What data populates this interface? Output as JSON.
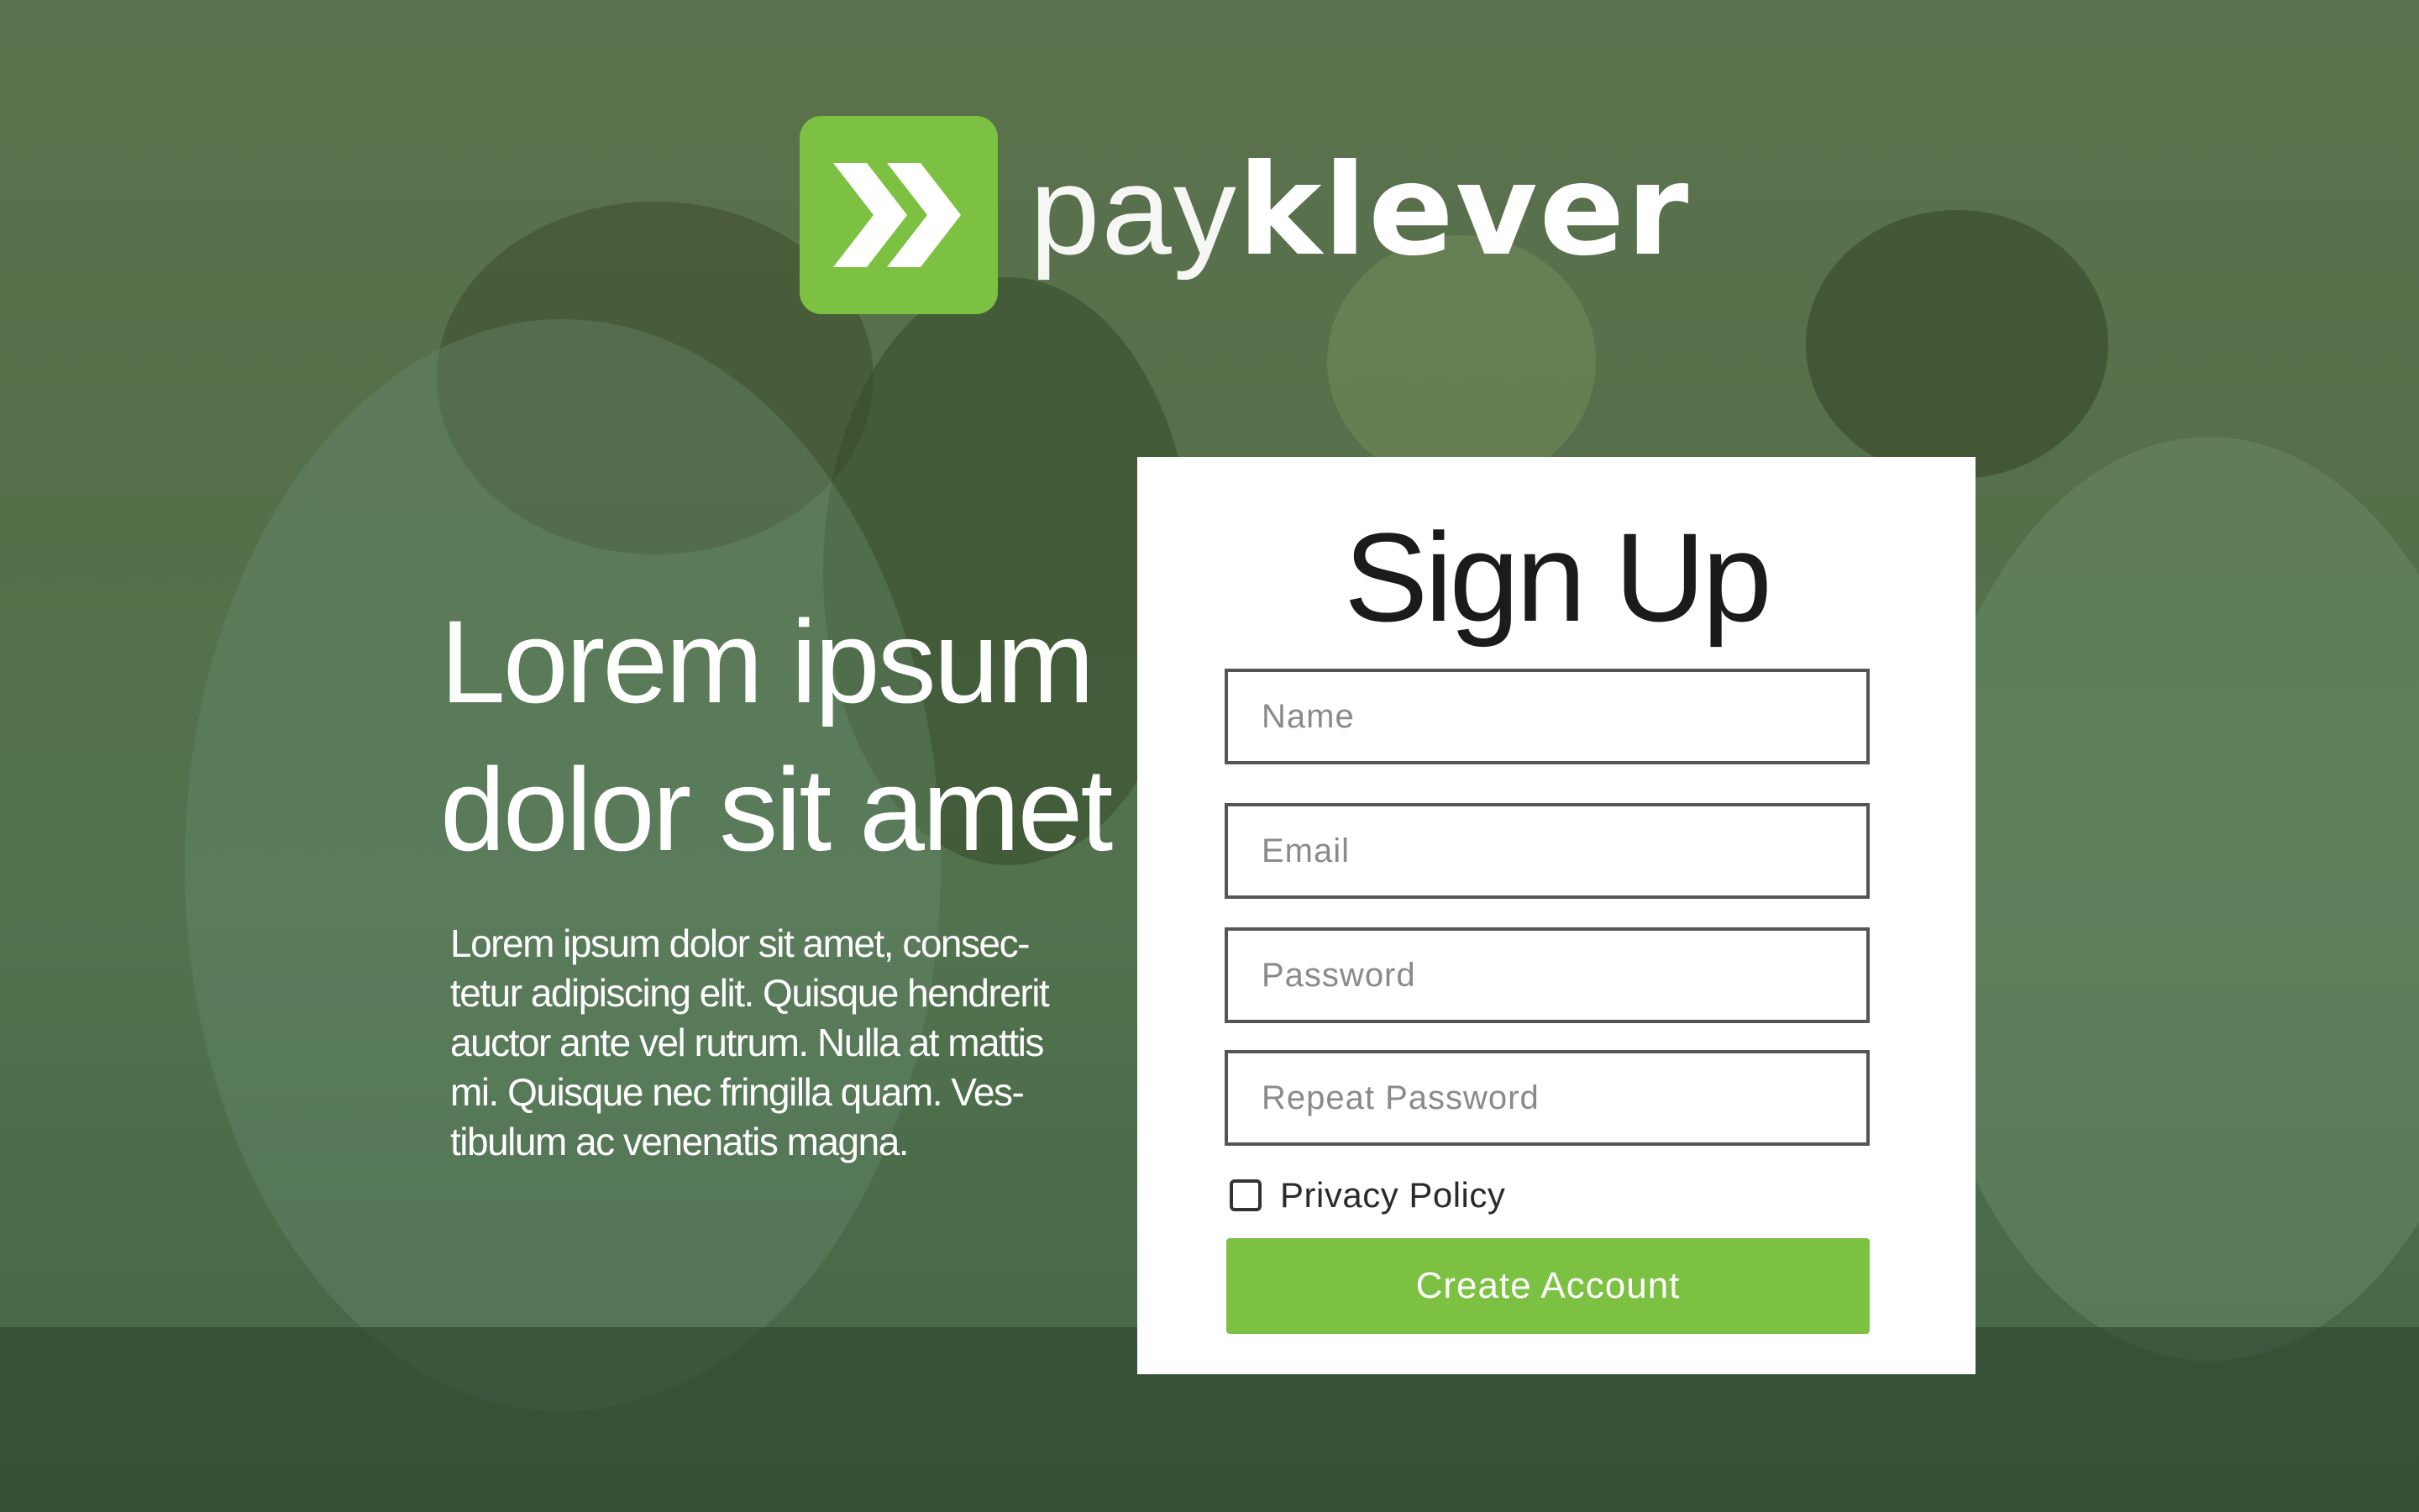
{
  "brand": {
    "name_light": "pay",
    "name_bold": "klever",
    "logo_icon": "double-chevron-right-icon",
    "accent_color": "#7cc142"
  },
  "hero": {
    "title_line1": "Lorem ipsum",
    "title_line2": "dolor sit amet",
    "body_lines": [
      "Lorem ipsum dolor sit amet, consec-",
      "tetur adipiscing elit. Quisque hendrerit",
      "auctor ante vel rutrum. Nulla at mattis",
      "mi. Quisque nec fringilla quam. Ves-",
      "tibulum ac venenatis magna."
    ]
  },
  "signup": {
    "title": "Sign Up",
    "fields": {
      "name_placeholder": "Name",
      "email_placeholder": "Email",
      "password_placeholder": "Password",
      "repeat_password_placeholder": "Repeat Password"
    },
    "privacy_label": "Privacy Policy",
    "privacy_checked": false,
    "submit_label": "Create Account"
  }
}
